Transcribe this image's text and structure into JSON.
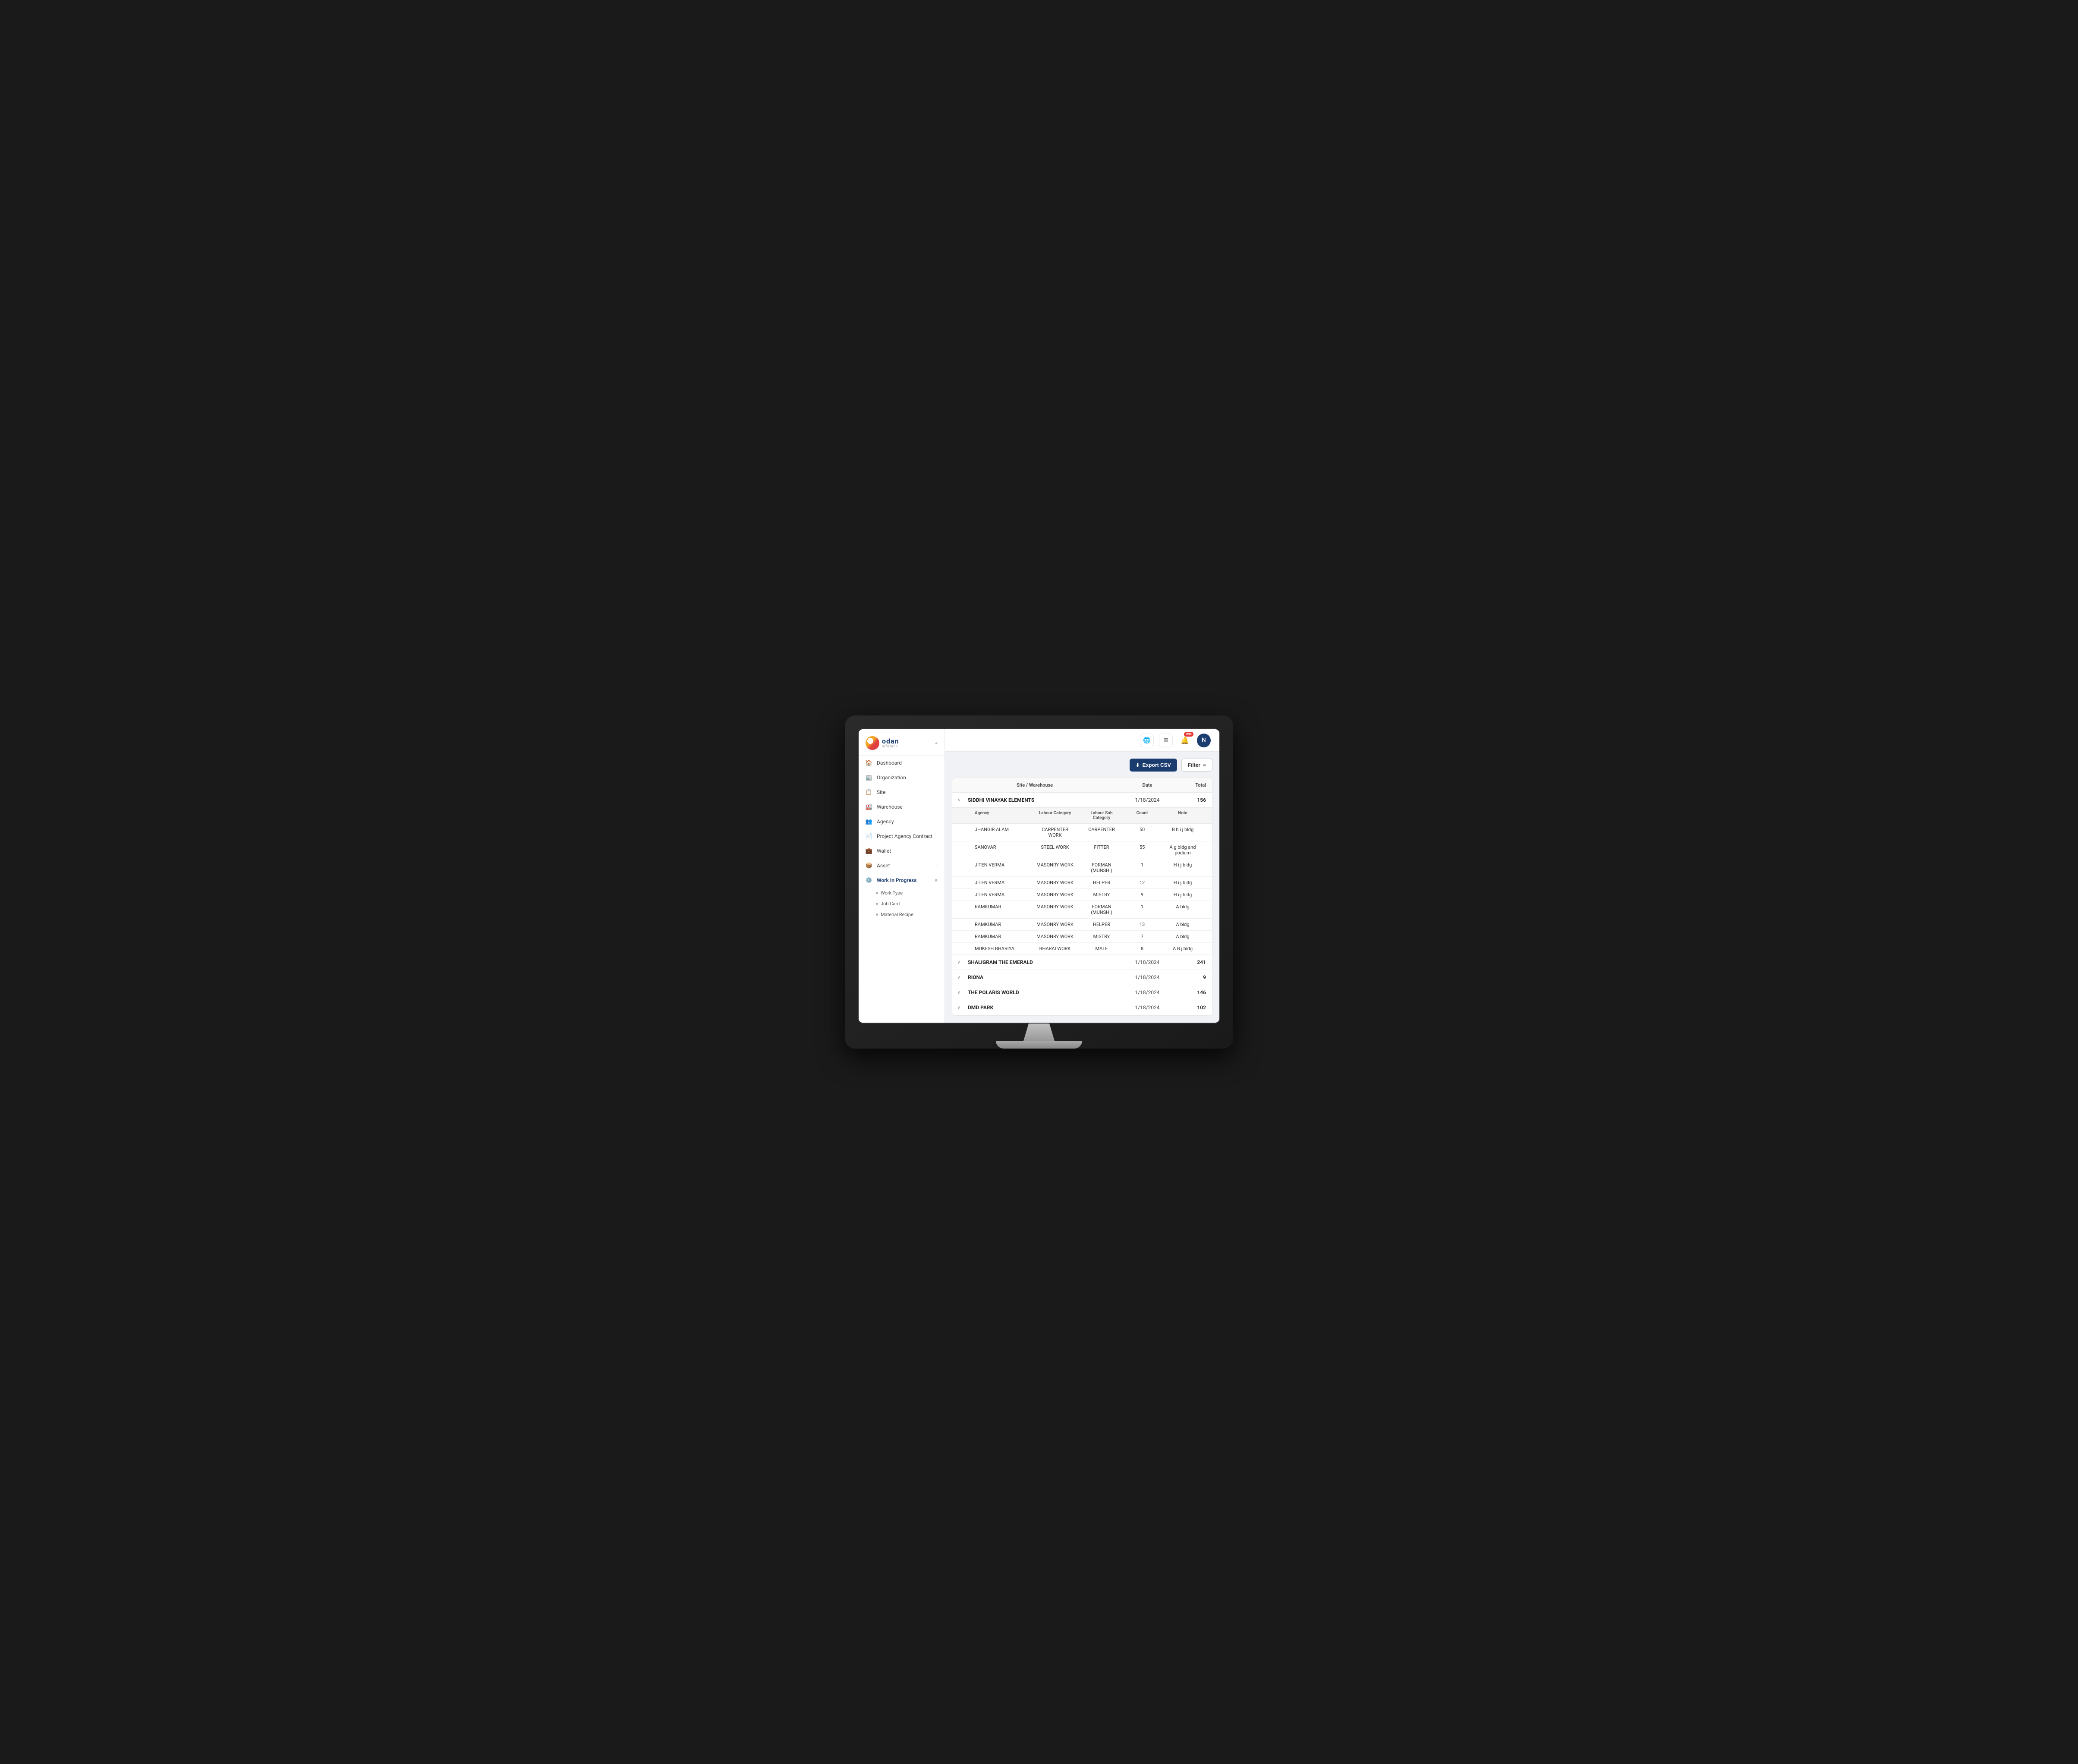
{
  "logo": {
    "name": "odan",
    "sub": "infotech"
  },
  "header": {
    "notif_count": "99+",
    "avatar_initial": "N"
  },
  "toolbar": {
    "export_label": "Export CSV",
    "filter_label": "Filter"
  },
  "sidebar": {
    "items": [
      {
        "id": "dashboard",
        "label": "Dashboard",
        "icon": "🏠"
      },
      {
        "id": "organization",
        "label": "Organization",
        "icon": "🏢"
      },
      {
        "id": "site",
        "label": "Site",
        "icon": "📋"
      },
      {
        "id": "warehouse",
        "label": "Warehouse",
        "icon": "🏭"
      },
      {
        "id": "agency",
        "label": "Agency",
        "icon": "👥"
      },
      {
        "id": "project-agency-contract",
        "label": "Project Agency Contract",
        "icon": "📄"
      },
      {
        "id": "wallet",
        "label": "Wallet",
        "icon": "💼"
      },
      {
        "id": "asset",
        "label": "Asset",
        "icon": "📦",
        "has_children": true
      },
      {
        "id": "work-in-progress",
        "label": "Work In Progress",
        "icon": "⚙️",
        "has_children": true,
        "expanded": true
      }
    ],
    "sub_items": [
      {
        "id": "work-type",
        "label": "Work Type"
      },
      {
        "id": "job-card",
        "label": "Job Card"
      },
      {
        "id": "material-recipe",
        "label": "Material Recipe"
      }
    ]
  },
  "table": {
    "columns": [
      "Site / Warehouse",
      "Date",
      "Total"
    ],
    "sub_columns": [
      "Agency",
      "Labour Category",
      "Labour Sub Category",
      "Count",
      "Note"
    ],
    "groups": [
      {
        "name": "SIDDHI VINAYAK ELEMENTS",
        "date": "1/18/2024",
        "total": "156",
        "expanded": true,
        "rows": [
          {
            "agency": "JHANGIR ALAM",
            "labour_cat": "CARPENTER WORK",
            "labour_sub": "CARPENTER",
            "count": "50",
            "note": "B h i j bldg"
          },
          {
            "agency": "SANOVAR",
            "labour_cat": "STEEL WORK",
            "labour_sub": "FITTER",
            "count": "55",
            "note": "A g bldg and podium"
          },
          {
            "agency": "JITEN VERMA",
            "labour_cat": "MASONRY WORK",
            "labour_sub": "FORMAN (MUNSHI)",
            "count": "1",
            "note": "H i j bldg"
          },
          {
            "agency": "JITEN VERMA",
            "labour_cat": "MASONRY WORK",
            "labour_sub": "HELPER",
            "count": "12",
            "note": "H i j bldg"
          },
          {
            "agency": "JITEN VERMA",
            "labour_cat": "MASONRY WORK",
            "labour_sub": "MISTRY",
            "count": "9",
            "note": "H i j bldg"
          },
          {
            "agency": "RAMKUMAR",
            "labour_cat": "MASONRY WORK",
            "labour_sub": "FORMAN (MUNSHI)",
            "count": "1",
            "note": "A bldg"
          },
          {
            "agency": "RAMKUMAR",
            "labour_cat": "MASONRY WORK",
            "labour_sub": "HELPER",
            "count": "13",
            "note": "A bldg"
          },
          {
            "agency": "RAMKUMAR",
            "labour_cat": "MASONRY WORK",
            "labour_sub": "MISTRY",
            "count": "7",
            "note": "A bldg"
          },
          {
            "agency": "MUKESH BHARIYA",
            "labour_cat": "BHARAI WORK",
            "labour_sub": "MALE",
            "count": "8",
            "note": "A B j bldg"
          }
        ]
      },
      {
        "name": "SHALIGRAM THE EMERALD",
        "date": "1/18/2024",
        "total": "241",
        "expanded": false,
        "rows": []
      },
      {
        "name": "RIONA",
        "date": "1/18/2024",
        "total": "9",
        "expanded": false,
        "rows": []
      },
      {
        "name": "THE POLARIS WORLD",
        "date": "1/18/2024",
        "total": "146",
        "expanded": false,
        "rows": []
      },
      {
        "name": "DMD PARK",
        "date": "1/18/2024",
        "total": "102",
        "expanded": false,
        "rows": []
      }
    ]
  },
  "icons": {
    "collapse": "«",
    "chevron_down": "∨",
    "chevron_up": "∧",
    "export": "↓",
    "filter_lines": "≡",
    "bell": "🔔",
    "translate": "🌐",
    "mail": "✉"
  }
}
